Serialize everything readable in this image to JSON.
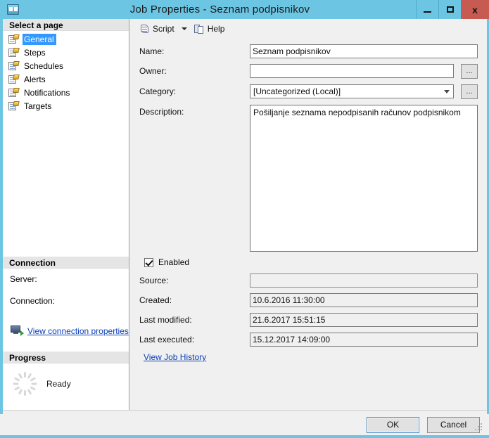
{
  "window": {
    "title": "Job Properties - Seznam podpisnikov",
    "app_icon": "ssms-icon",
    "minimize_label": "–",
    "maximize_label": "□",
    "close_label": "x"
  },
  "sidebar": {
    "select_page_header": "Select a page",
    "items": [
      {
        "label": "General",
        "icon": "page-icon",
        "selected": true
      },
      {
        "label": "Steps",
        "icon": "page-icon",
        "selected": false
      },
      {
        "label": "Schedules",
        "icon": "page-icon",
        "selected": false
      },
      {
        "label": "Alerts",
        "icon": "page-icon",
        "selected": false
      },
      {
        "label": "Notifications",
        "icon": "page-icon",
        "selected": false
      },
      {
        "label": "Targets",
        "icon": "page-icon",
        "selected": false
      }
    ],
    "connection": {
      "header": "Connection",
      "server_label": "Server:",
      "server_value": "",
      "connection_label": "Connection:",
      "connection_value": "",
      "view_properties_link": "View connection properties",
      "link_icon": "connection-monitor-icon"
    },
    "progress": {
      "header": "Progress",
      "status": "Ready",
      "spinner_icon": "progress-spinner-icon"
    }
  },
  "toolbar": {
    "script_label": "Script",
    "script_icon": "script-scroll-icon",
    "dropdown_icon": "chevron-down-icon",
    "help_label": "Help",
    "help_icon": "help-pages-icon"
  },
  "form": {
    "name_label": "Name:",
    "name_value": "Seznam podpisnikov",
    "owner_label": "Owner:",
    "owner_value": "",
    "owner_browse_label": "...",
    "category_label": "Category:",
    "category_value": "[Uncategorized (Local)]",
    "category_browse_label": "...",
    "description_label": "Description:",
    "description_value": "Pošiljanje seznama nepodpisanih računov podpisnikom",
    "enabled_label": "Enabled",
    "enabled_checked": true,
    "source_label": "Source:",
    "source_value": "",
    "created_label": "Created:",
    "created_value": "10.6.2016 11:30:00",
    "last_modified_label": "Last modified:",
    "last_modified_value": "21.6.2017 15:51:15",
    "last_executed_label": "Last executed:",
    "last_executed_value": "15.12.2017 14:09:00",
    "view_job_history_link": "View Job History"
  },
  "footer": {
    "ok_label": "OK",
    "cancel_label": "Cancel",
    "resize_grip_icon": "resize-grip-icon"
  },
  "colors": {
    "titlebar": "#6cc5e2",
    "close_button": "#c75b52",
    "selection": "#3399ff",
    "link": "#0b3fb5",
    "panel": "#f0f0f0",
    "section_header": "#e5e5e5"
  }
}
